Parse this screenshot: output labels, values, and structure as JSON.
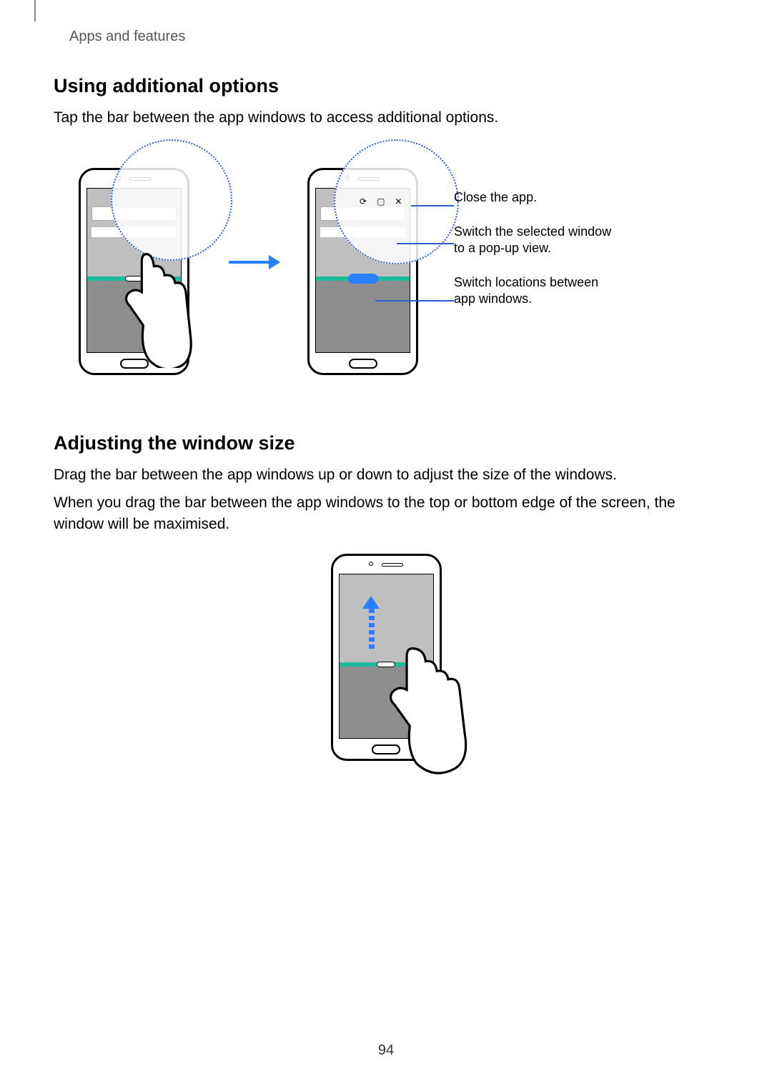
{
  "header": {
    "section": "Apps and features"
  },
  "page_number": "94",
  "sec1": {
    "heading": "Using additional options",
    "body": "Tap the bar between the app windows to access additional options."
  },
  "callouts": {
    "close": "Close the app.",
    "popup": "Switch the selected window to a pop-up view.",
    "switch": "Switch locations between app windows."
  },
  "sec2": {
    "heading": "Adjusting the window size",
    "body1": "Drag the bar between the app windows up or down to adjust the size of the windows.",
    "body2": "When you drag the bar between the app windows to the top or bottom edge of the screen, the window will be maximised."
  },
  "icons": {
    "switch_glyph": "⟳",
    "popup_glyph": "▢",
    "close_glyph": "✕"
  }
}
